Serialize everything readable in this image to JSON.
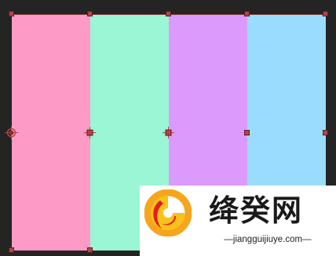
{
  "canvas": {
    "background": "#242424"
  },
  "shapes": [
    {
      "id": "pink",
      "color": "#fd9ac5"
    },
    {
      "id": "mint",
      "color": "#9af6d4"
    },
    {
      "id": "purple",
      "color": "#dc9afd"
    },
    {
      "id": "blue",
      "color": "#9adcfd"
    }
  ],
  "handle_color": "#b14545",
  "watermark": {
    "title": "绛癸网",
    "url": "—jiangguijiuye.com—",
    "logo_colors": {
      "ring": "#f7a51c",
      "swoosh": "#e0201a"
    }
  }
}
